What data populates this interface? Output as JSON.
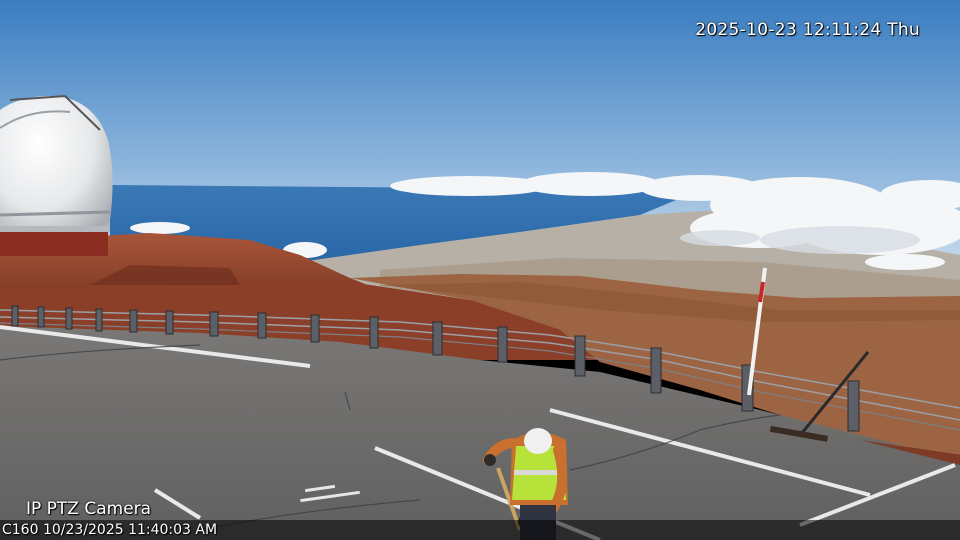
{
  "overlay": {
    "timestamp_top": "2025-10-23 12:11:24 Thu",
    "camera_name": "IP PTZ Camera",
    "timestamp_bottom": "C160 10/23/2025 11:40:03 AM"
  },
  "scene": {
    "colors": {
      "sky_top": "#3d7fc0",
      "sky_horizon": "#cfe0ee",
      "ocean": "#2d6fb0",
      "cinder": "#9a4a2e",
      "asphalt": "#6b6b6b"
    }
  }
}
